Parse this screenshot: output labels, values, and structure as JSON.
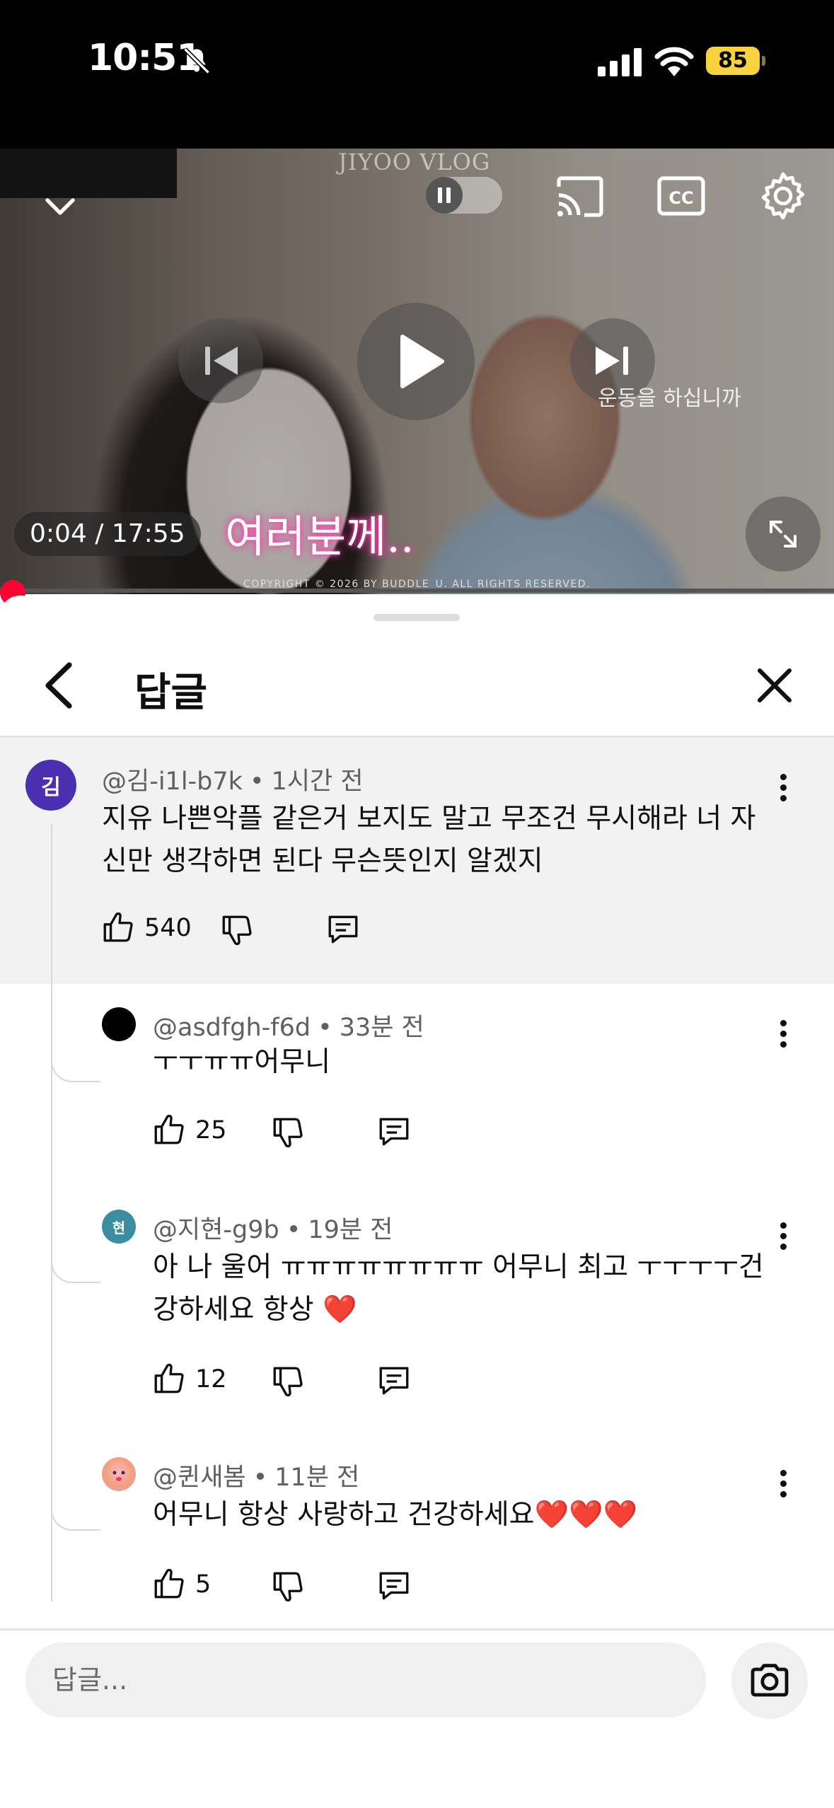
{
  "status_bar": {
    "time": "10:51",
    "battery": "85",
    "battery_color": "#f7d23c"
  },
  "video": {
    "watermark": "JIYOO VLOG",
    "time_display": "0:04 / 17:55",
    "caption": "여러분께..",
    "subtitle": "운동을 하십니까",
    "copyright": "COPYRIGHT © 2026 BY BUDDLE_U. ALL RIGHTS RESERVED.",
    "progress_fraction": 0.004,
    "progress_color": "#ff0033"
  },
  "sheet": {
    "title": "답글",
    "input_placeholder": "답글..."
  },
  "parent_comment": {
    "author": "@김-i1l-b7k",
    "time": "1시간 전",
    "avatar_text": "김",
    "avatar_color": "#4a2fb0",
    "text": "지유 나쁜악플 같은거  보지도  말고  무조건  무시해라  너 자신만  생각하면   된다  무슨뜻인지  알겠지",
    "likes": "540"
  },
  "replies": [
    {
      "author": "@asdfgh-f6d",
      "time": "33분 전",
      "text": "ㅜㅜㅠㅠ어무니",
      "likes": "25",
      "avatar_color": "#000000"
    },
    {
      "author": "@지현-g9b",
      "time": "19분 전",
      "avatar_text": "현",
      "avatar_color": "#3a8ea0",
      "text": "아 나 울어 ㅠㅠㅠㅠㅠㅠㅠㅠ 어무니 최고 ㅜㅜㅜㅜ건강하세요 항상 ❤️",
      "likes": "12"
    },
    {
      "author": "@퀸새봄",
      "time": "11분 전",
      "text": "어무니 항상 사랑하고 건강하세요❤️❤️❤️",
      "likes": "5"
    }
  ],
  "separator": "•"
}
